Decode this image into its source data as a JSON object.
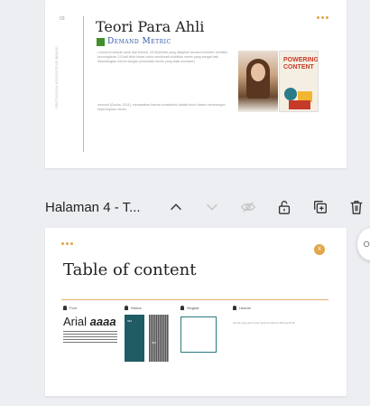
{
  "slide3": {
    "number": "03",
    "title": "Teori Para Ahli",
    "brand": "Demand Metric",
    "paragraph1": "• menurut sebuah studi dari Demric, 2019(sekitar yang disajikan secara konsisten memiliki kemungkinan 3,5 kali lebih besar untuk menikmati visibilitas merek yang sangat baik dibandingkan merek dengan presentasi merek yang tidak konsisten.",
    "paragraph2": "menurut (Bucha, 2014), menyatakan bahwa konsistensi adalah kunci dalam membangun kepercayaan merek.",
    "vertical_text": "PENTINGNYA KONSISTENSI BRAND",
    "book_title": "POWERING CONTENT"
  },
  "toolbar": {
    "page_title": "Halaman 4 - T..."
  },
  "slide4": {
    "badge": "X",
    "title": "Table of content",
    "col_font": "Font",
    "col_warna": "Warna",
    "col_singkat": "Singkat",
    "col_ukuran": "Ukuran",
    "font_sample": "Arial ",
    "font_sample_bold": "aaaa",
    "size_text": "ukuran logo dan huruf minimal ukuran 16/14px/6.32",
    "swatch1_label": "HEX",
    "swatch2_label": "HEX"
  },
  "icons": {
    "up": "chevron-up-icon",
    "down": "chevron-down-icon",
    "hide": "eye-off-icon",
    "lock": "lock-icon",
    "copy": "duplicate-icon",
    "trash": "trash-icon",
    "edge": "search-icon"
  },
  "colors": {
    "accent": "#e3a64a",
    "teal": "#1f5c63",
    "brand_blue": "#2e5aa8"
  }
}
